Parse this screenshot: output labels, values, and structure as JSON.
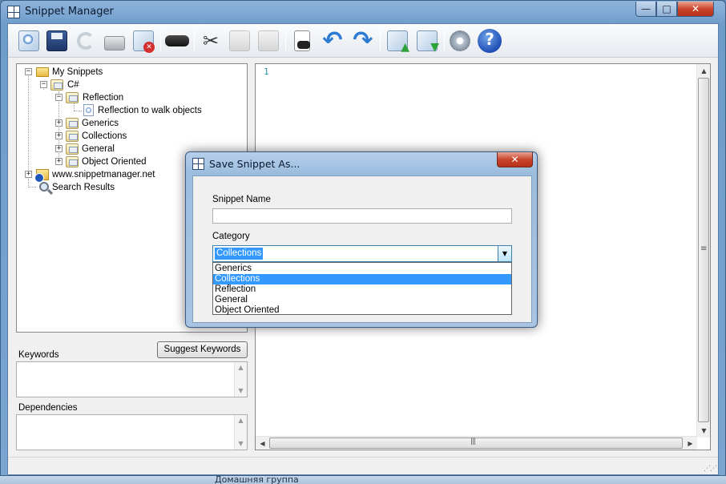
{
  "window": {
    "title": "Snippet Manager",
    "minimize": "—",
    "maximize": "□",
    "close": "✕"
  },
  "toolbar": {
    "buttons": [
      {
        "icon": "new-snippet-icon"
      },
      {
        "icon": "save-icon"
      },
      {
        "icon": "refresh-icon"
      },
      {
        "icon": "print-icon"
      },
      {
        "icon": "delete-snippet-icon"
      },
      {
        "icon": "find-icon"
      },
      {
        "icon": "cut-icon"
      },
      {
        "icon": "copy-icon"
      },
      {
        "icon": "paste-icon"
      },
      {
        "icon": "find-in-document-icon"
      },
      {
        "icon": "undo-icon"
      },
      {
        "icon": "redo-icon"
      },
      {
        "icon": "export-icon"
      },
      {
        "icon": "import-icon"
      },
      {
        "icon": "settings-gear-icon"
      },
      {
        "icon": "help-icon",
        "glyph": "?"
      }
    ]
  },
  "tree": {
    "root": "My Snippets",
    "csharp": "C#",
    "reflection": "Reflection",
    "reflection_item": "Reflection to walk objects",
    "generics": "Generics",
    "collections": "Collections",
    "general": "General",
    "object_oriented": "Object Oriented",
    "website": "www.snippetmanager.net",
    "search_results": "Search Results"
  },
  "keywords": {
    "label": "Keywords",
    "suggest_button": "Suggest Keywords",
    "value": ""
  },
  "dependencies": {
    "label": "Dependencies",
    "value": ""
  },
  "editor": {
    "line_number": "1"
  },
  "dialog": {
    "title": "Save Snippet As...",
    "close": "✕",
    "name_label": "Snippet Name",
    "name_value": "",
    "category_label": "Category",
    "category_selected": "Collections",
    "category_options": [
      "Generics",
      "Collections",
      "Reflection",
      "General",
      "Object Oriented"
    ],
    "selected_index": 1
  },
  "taskbar": {
    "peek_text": "Домашняя группа"
  }
}
